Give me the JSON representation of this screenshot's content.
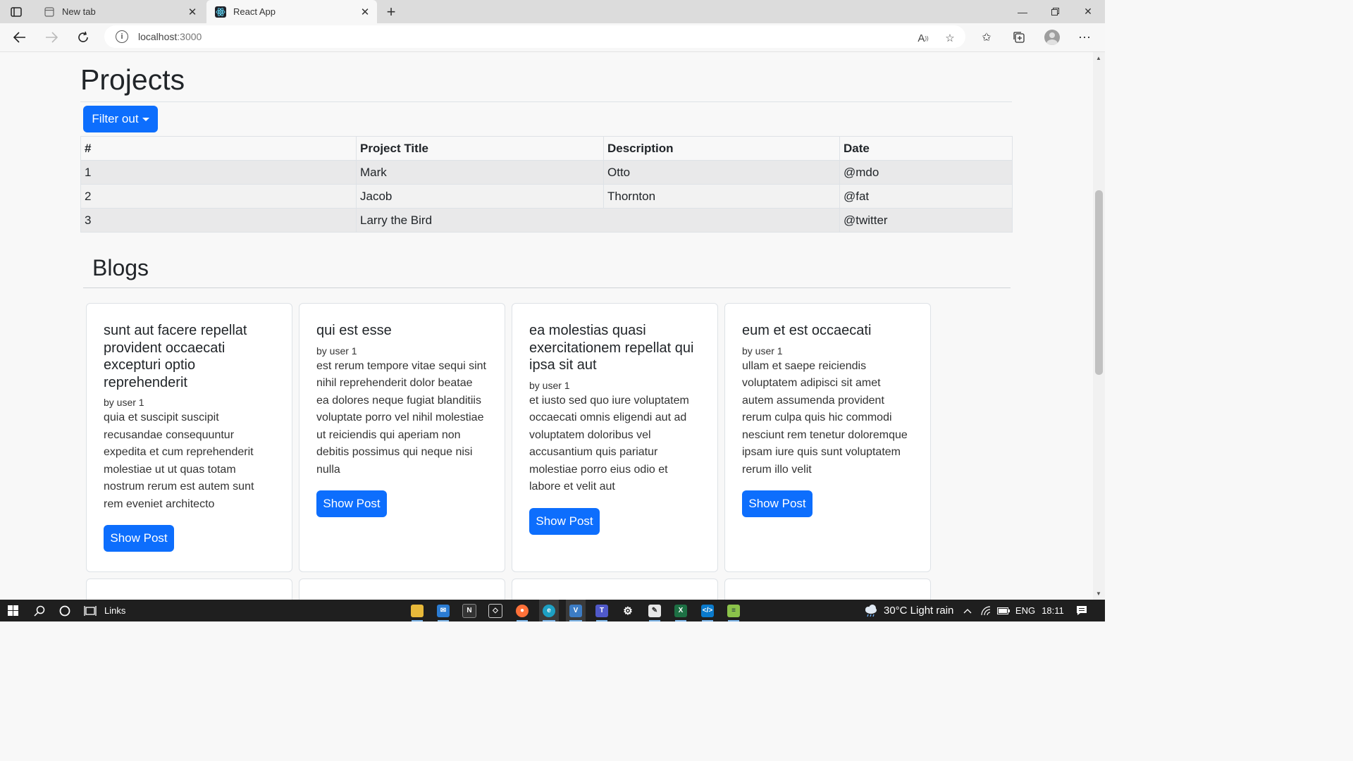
{
  "browser": {
    "tabs": [
      {
        "title": "New tab"
      },
      {
        "title": "React App"
      }
    ],
    "url": "localhost",
    "url_port": ":3000"
  },
  "page": {
    "projects_heading": "Projects",
    "filter_button": "Filter out",
    "table": {
      "headers": [
        "#",
        "Project Title",
        "Description",
        "Date"
      ],
      "rows": [
        [
          "1",
          "Mark",
          "Otto",
          "@mdo"
        ],
        [
          "2",
          "Jacob",
          "Thornton",
          "@fat"
        ],
        [
          "3",
          "Larry the Bird",
          "",
          "@twitter"
        ]
      ]
    },
    "blogs_heading": "Blogs",
    "posts": [
      {
        "title": "sunt aut facere repellat provident occaecati excepturi optio reprehenderit",
        "author": "by user 1",
        "body": "quia et suscipit suscipit recusandae consequuntur expedita et cum reprehenderit molestiae ut ut quas totam nostrum rerum est autem sunt rem eveniet architecto",
        "button": "Show Post"
      },
      {
        "title": "qui est esse",
        "author": "by user 1",
        "body": "est rerum tempore vitae sequi sint nihil reprehenderit dolor beatae ea dolores neque fugiat blanditiis voluptate porro vel nihil molestiae ut reiciendis qui aperiam non debitis possimus qui neque nisi nulla",
        "button": "Show Post"
      },
      {
        "title": "ea molestias quasi exercitationem repellat qui ipsa sit aut",
        "author": "by user 1",
        "body": "et iusto sed quo iure voluptatem occaecati omnis eligendi aut ad voluptatem doloribus vel accusantium quis pariatur molestiae porro eius odio et labore et velit aut",
        "button": "Show Post"
      },
      {
        "title": "eum et est occaecati",
        "author": "by user 1",
        "body": "ullam et saepe reiciendis voluptatem adipisci sit amet autem assumenda provident rerum culpa quis hic commodi nesciunt rem tenetur doloremque ipsam iure quis sunt voluptatem rerum illo velit",
        "button": "Show Post"
      }
    ]
  },
  "taskbar": {
    "links_label": "Links",
    "weather": "30°C  Light rain",
    "language": "ENG",
    "time": "18:11"
  },
  "colors": {
    "primary": "#0d6efd",
    "taskbar": "#1f1f1f"
  }
}
